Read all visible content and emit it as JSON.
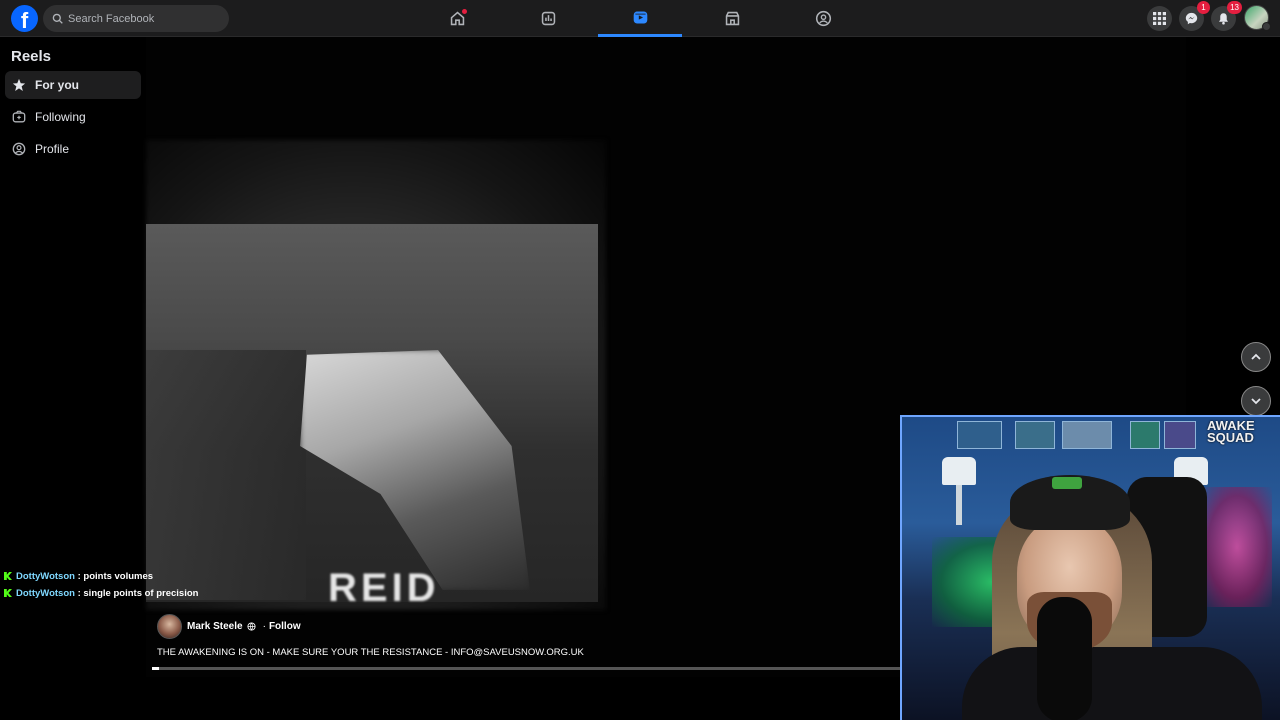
{
  "header": {
    "logo_letter": "f",
    "search_placeholder": "Search Facebook",
    "messenger_badge": "1",
    "notifications_badge": "13"
  },
  "sidebar": {
    "title": "Reels",
    "items": [
      {
        "label": "For you",
        "icon": "star-icon",
        "active": true
      },
      {
        "label": "Following",
        "icon": "following-icon",
        "active": false
      },
      {
        "label": "Profile",
        "icon": "profile-icon",
        "active": false
      }
    ]
  },
  "video": {
    "overlay_text": "REID"
  },
  "chat": [
    {
      "user": "DottyWotson",
      "message": "points volumes"
    },
    {
      "user": "DottyWotson",
      "message": "single points of precision"
    }
  ],
  "reel": {
    "author": "Mark Steele",
    "follow_label": "Follow",
    "separator": "·",
    "caption": "THE AWAKENING IS ON - MAKE SURE YOUR THE RESISTANCE - INFO@SAVEUSNOW.ORG.UK",
    "progress": 0.01
  },
  "webcam": {
    "sign_line1": "AWAKE",
    "sign_line2": "SQUAD"
  },
  "colors": {
    "accent": "#2d88ff",
    "badge": "#e41e3f",
    "kick_green": "#53fc18"
  }
}
